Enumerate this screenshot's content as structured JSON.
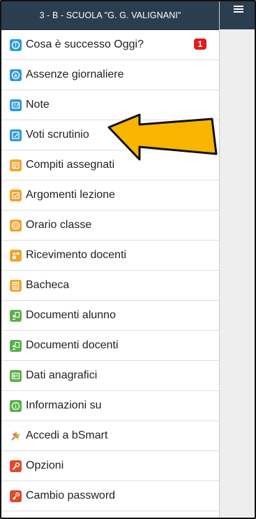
{
  "header": {
    "title": "3 - B - SCUOLA \"G. G. VALIGNANI\""
  },
  "menu": [
    {
      "label": "Cosa è successo Oggi?",
      "icon": "alert-icon",
      "color": "#2e9bd6",
      "badge": "1"
    },
    {
      "label": "Assenze giornaliere",
      "icon": "absence-icon",
      "color": "#2e9bd6"
    },
    {
      "label": "Note",
      "icon": "note-icon",
      "color": "#2e9bd6"
    },
    {
      "label": "Voti scrutinio",
      "icon": "grades-icon",
      "color": "#2e9bd6"
    },
    {
      "label": "Compiti assegnati",
      "icon": "homework-icon",
      "color": "#f0a531"
    },
    {
      "label": "Argomenti lezione",
      "icon": "lesson-topics-icon",
      "color": "#f0a531"
    },
    {
      "label": "Orario classe",
      "icon": "timetable-icon",
      "color": "#f0a531"
    },
    {
      "label": "Ricevimento docenti",
      "icon": "meeting-icon",
      "color": "#f0a531"
    },
    {
      "label": "Bacheca",
      "icon": "noticeboard-icon",
      "color": "#f0a531"
    },
    {
      "label": "Documenti alunno",
      "icon": "student-documents-icon",
      "color": "#5ab04a"
    },
    {
      "label": "Documenti docenti",
      "icon": "teacher-documents-icon",
      "color": "#5ab04a"
    },
    {
      "label": "Dati anagrafici",
      "icon": "personal-data-icon",
      "color": "#5ab04a"
    },
    {
      "label": "Informazioni su",
      "icon": "info-icon",
      "color": "#5ab04a"
    },
    {
      "label": "Accedi a bSmart",
      "icon": "bsmart-icon",
      "color": "#e3a22a"
    },
    {
      "label": "Opzioni",
      "icon": "wrench-icon",
      "color": "#e24a2a"
    },
    {
      "label": "Cambio password",
      "icon": "key-icon",
      "color": "#e24a2a"
    }
  ],
  "annotation": {
    "icon": "pointer-arrow-icon",
    "color": "#f7b500"
  }
}
